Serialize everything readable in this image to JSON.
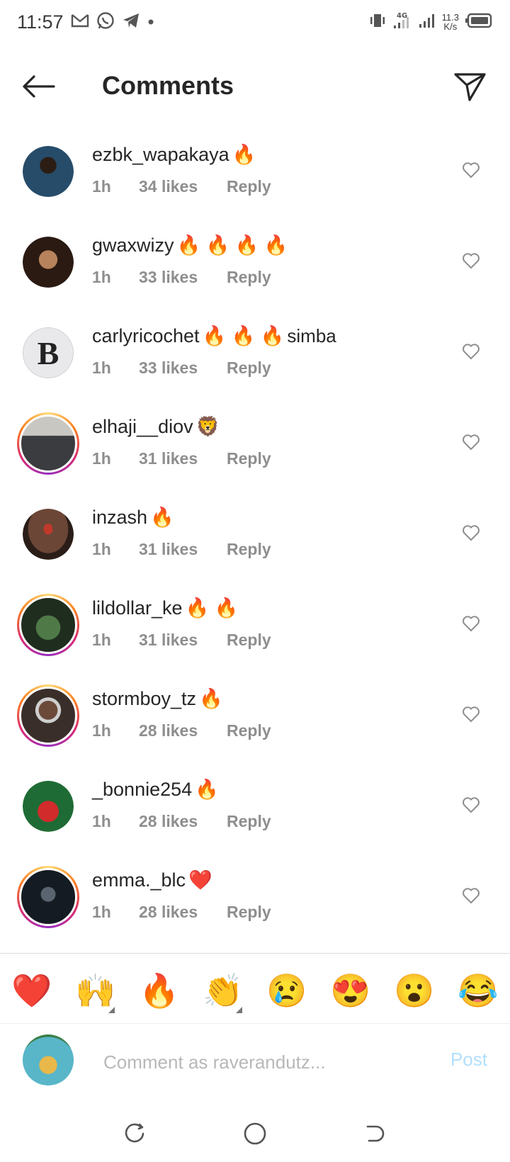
{
  "status": {
    "time": "11:57",
    "network_type": "4G",
    "net_speed_value": "11.3",
    "net_speed_unit": "K/s"
  },
  "header": {
    "title": "Comments"
  },
  "comments": [
    {
      "username": "ezbk_wapakaya",
      "emoji": "🔥",
      "text": "",
      "time": "1h",
      "likes": "34 likes",
      "reply": "Reply",
      "avatar_color": "#1e5e8a"
    },
    {
      "username": "gwaxwizy",
      "emoji": "🔥 🔥 🔥 🔥",
      "text": "",
      "time": "1h",
      "likes": "33 likes",
      "reply": "Reply",
      "avatar_color": "#3b2418"
    },
    {
      "username": "carlyricochet",
      "emoji": "🔥 🔥 🔥",
      "text": "simba",
      "time": "1h",
      "likes": "33 likes",
      "reply": "Reply",
      "avatar_color": "#e9e9ec"
    },
    {
      "username": "elhaji__diov",
      "emoji": "🦁",
      "text": "",
      "time": "1h",
      "likes": "31 likes",
      "reply": "Reply",
      "avatar_color": "#4a4e56"
    },
    {
      "username": "inzash",
      "emoji": "🔥",
      "text": "",
      "time": "1h",
      "likes": "31 likes",
      "reply": "Reply",
      "avatar_color": "#5a3a2e"
    },
    {
      "username": "lildollar_ke",
      "emoji": "🔥 🔥",
      "text": "",
      "time": "1h",
      "likes": "31 likes",
      "reply": "Reply",
      "avatar_color": "#2f4a2c"
    },
    {
      "username": "stormboy_tz",
      "emoji": "🔥",
      "text": "",
      "time": "1h",
      "likes": "28 likes",
      "reply": "Reply",
      "avatar_color": "#3a302c"
    },
    {
      "username": "_bonnie254",
      "emoji": "🔥",
      "text": "",
      "time": "1h",
      "likes": "28 likes",
      "reply": "Reply",
      "avatar_color": "#1f7a3a"
    },
    {
      "username": "emma._blc",
      "emoji": "❤️",
      "text": "",
      "time": "1h",
      "likes": "28 likes",
      "reply": "Reply",
      "avatar_color": "#1c2530"
    }
  ],
  "reactions": [
    "❤️",
    "🙌",
    "🔥",
    "👏",
    "😢",
    "😍",
    "😮",
    "😂"
  ],
  "composer": {
    "placeholder": "Comment as raverandutz...",
    "post_label": "Post"
  }
}
